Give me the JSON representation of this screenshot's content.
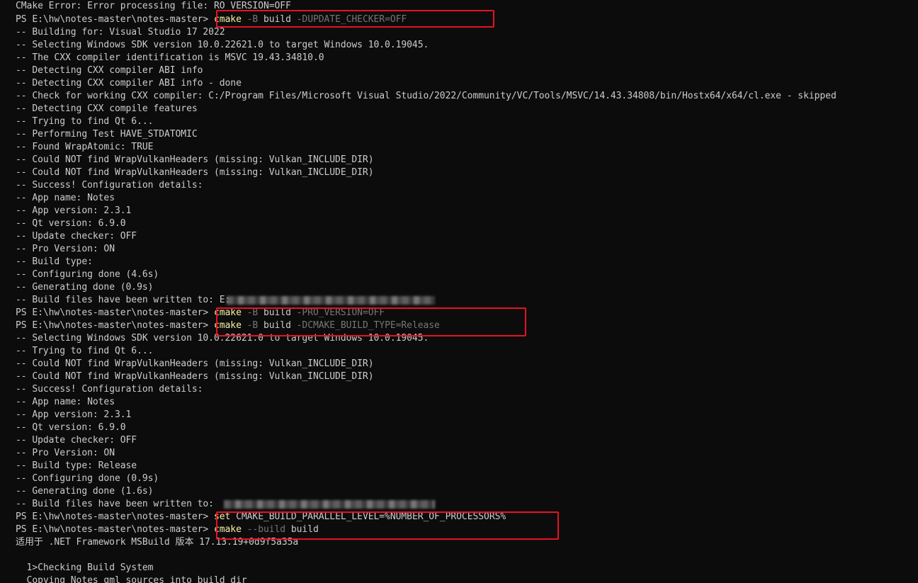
{
  "terminal": {
    "prompt": "PS E:\\hw\\notes-master\\notes-master> ",
    "highlight_color": "#e81123",
    "prompt_color": "#cccccc",
    "command_color": "#f9f1a5",
    "flag_color": "#767676",
    "lines": {
      "l0": "CMake Error: Error processing file: RO_VERSION=OFF",
      "l2": "-- Building for: Visual Studio 17 2022",
      "l3": "-- Selecting Windows SDK version 10.0.22621.0 to target Windows 10.0.19045.",
      "l4": "-- The CXX compiler identification is MSVC 19.43.34810.0",
      "l5": "-- Detecting CXX compiler ABI info",
      "l6": "-- Detecting CXX compiler ABI info - done",
      "l7": "-- Check for working CXX compiler: C:/Program Files/Microsoft Visual Studio/2022/Community/VC/Tools/MSVC/14.43.34808/bin/Hostx64/x64/cl.exe - skipped",
      "l8": "-- Detecting CXX compile features",
      "l9": "-- Trying to find Qt 6...",
      "l10": "-- Performing Test HAVE_STDATOMIC",
      "l11": "-- Found WrapAtomic: TRUE",
      "l12": "-- Could NOT find WrapVulkanHeaders (missing: Vulkan_INCLUDE_DIR)",
      "l13": "-- Could NOT find WrapVulkanHeaders (missing: Vulkan_INCLUDE_DIR)",
      "l14": "-- Success! Configuration details:",
      "l15": "-- App name: Notes",
      "l16": "-- App version: 2.3.1",
      "l17": "-- Qt version: 6.9.0",
      "l18": "-- Update checker: OFF",
      "l19": "-- Pro Version: ON",
      "l20": "-- Build type:",
      "l21": "-- Configuring done (4.6s)",
      "l22": "-- Generating done (0.9s)",
      "l23": "-- Build files have been written to: E:",
      "l26": "-- Selecting Windows SDK version 10.0.22621.0 to target Windows 10.0.19045.",
      "l27": "-- Trying to find Qt 6...",
      "l28": "-- Could NOT find WrapVulkanHeaders (missing: Vulkan_INCLUDE_DIR)",
      "l29": "-- Could NOT find WrapVulkanHeaders (missing: Vulkan_INCLUDE_DIR)",
      "l30": "-- Success! Configuration details:",
      "l31": "-- App name: Notes",
      "l32": "-- App version: 2.3.1",
      "l33": "-- Qt version: 6.9.0",
      "l34": "-- Update checker: OFF",
      "l35": "-- Pro Version: ON",
      "l36": "-- Build type: Release",
      "l37": "-- Configuring done (0.9s)",
      "l38": "-- Generating done (1.6s)",
      "l39": "-- Build files have been written to:",
      "l42": "适用于 .NET Framework MSBuild 版本 17.13.19+0d9f5a35a",
      "l43": "",
      "l44": "  1>Checking Build System",
      "l45": "  Copying Notes qml sources into build dir"
    },
    "commands": {
      "c1": {
        "cmd": "cmake",
        "a1": " -B ",
        "arg": "build",
        "a2": " -DUPDATE_CHECKER=OFF"
      },
      "c2": {
        "cmd": "cmake",
        "a1": " -B ",
        "arg": "build",
        "a2": " -PRO_VERSION=OFF"
      },
      "c3": {
        "cmd": "cmake",
        "a1": " -B ",
        "arg": "build",
        "a2": " -DCMAKE_BUILD_TYPE=Release"
      },
      "c4": {
        "cmd": "set",
        "a1": "",
        "arg": " CMAKE_BUILD_PARALLEL_LEVEL=%NUMBER_OF_PROCESSORS%",
        "a2": ""
      },
      "c5": {
        "cmd": "cmake",
        "a1": " --build ",
        "arg": "build",
        "a2": ""
      }
    }
  }
}
